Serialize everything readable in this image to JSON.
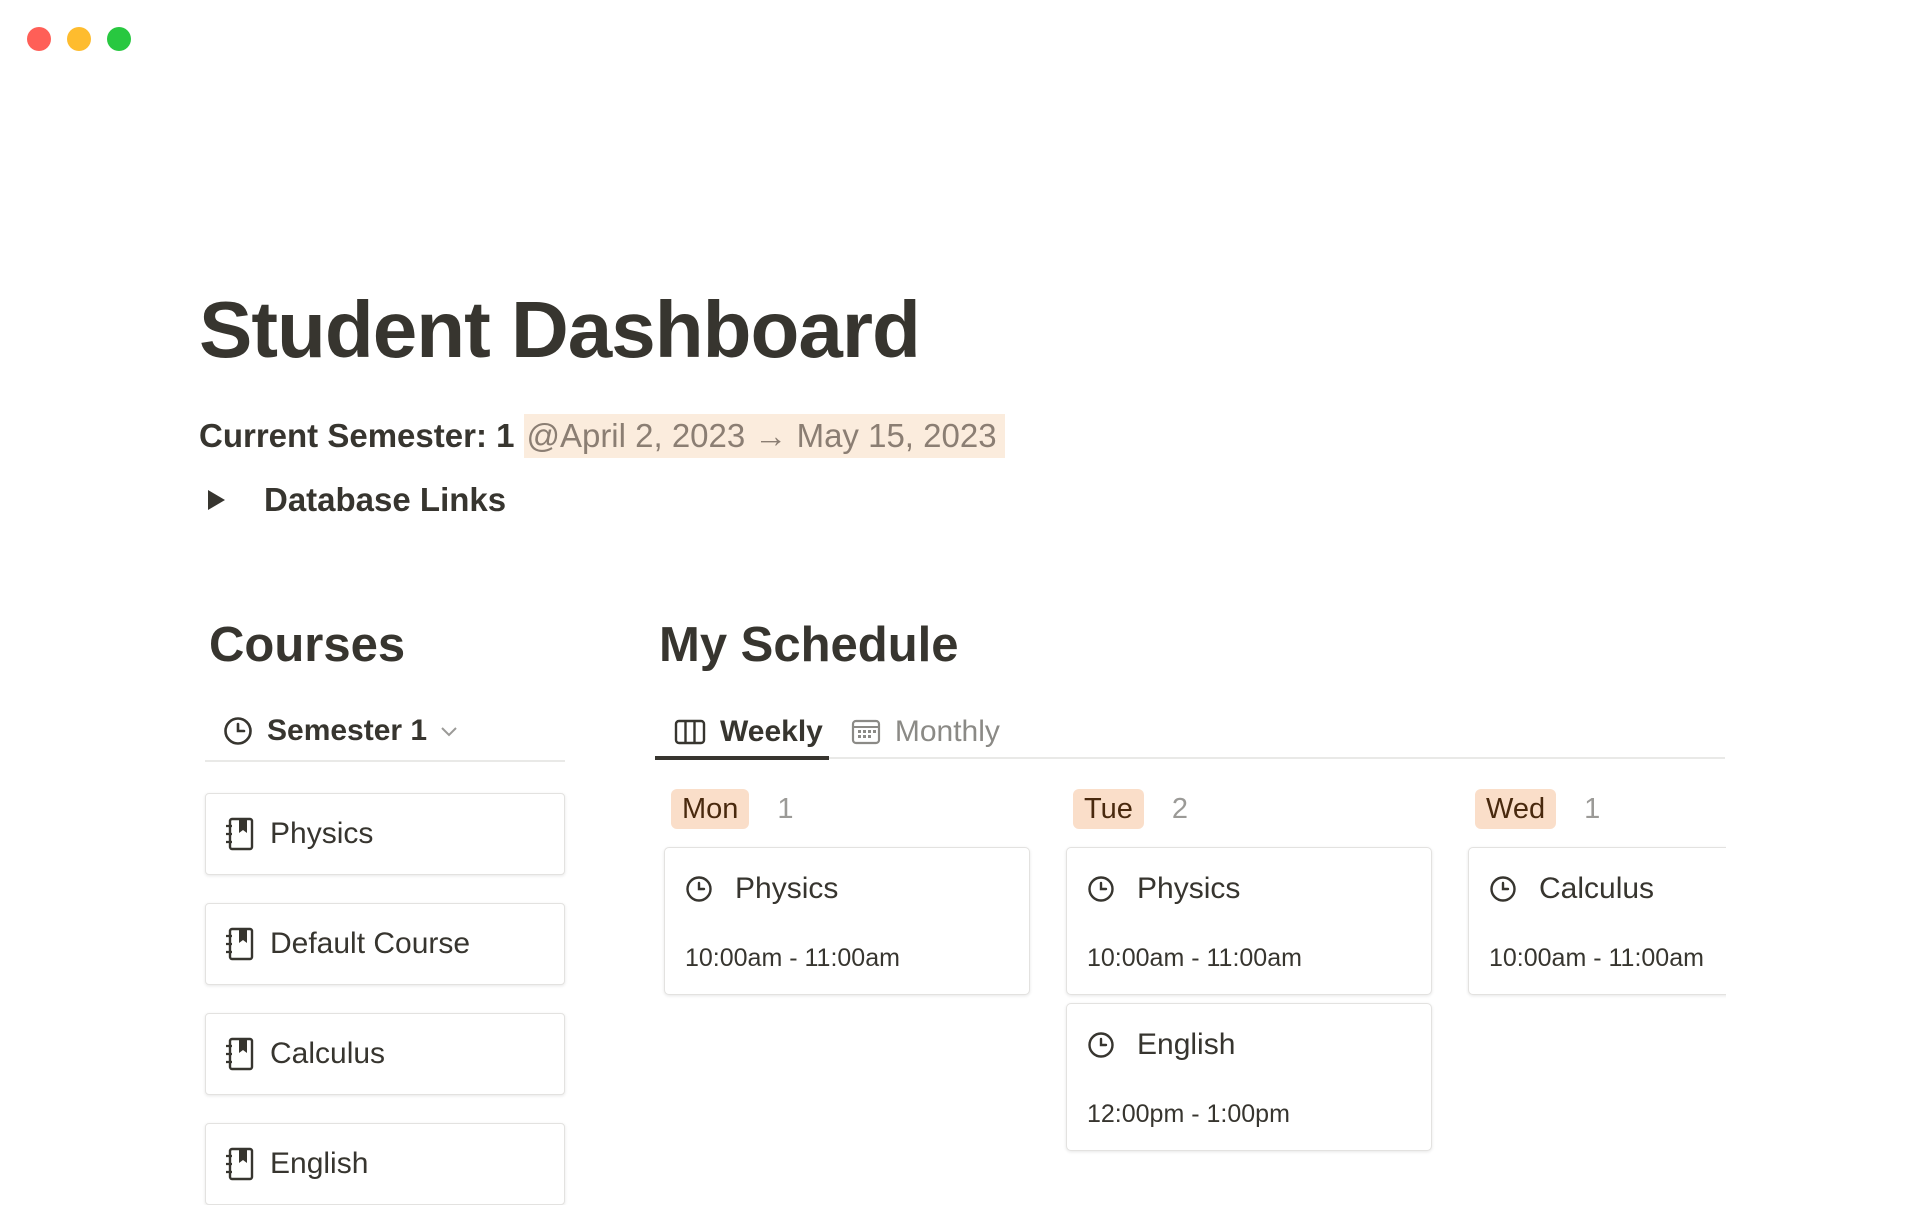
{
  "window": {
    "controls": {
      "close_color": "#ff5f57",
      "minimize_color": "#febc2e",
      "maximize_color": "#28c840"
    }
  },
  "page": {
    "title": "Student Dashboard",
    "semester_label": "Current Semester: 1",
    "semester_dates": "@April 2, 2023 → May 15, 2023",
    "toggle_label": "Database Links"
  },
  "courses": {
    "heading": "Courses",
    "view_label": "Semester 1",
    "items": [
      {
        "label": "Physics"
      },
      {
        "label": "Default Course"
      },
      {
        "label": "Calculus"
      },
      {
        "label": "English"
      }
    ]
  },
  "schedule": {
    "heading": "My Schedule",
    "tabs": [
      {
        "label": "Weekly",
        "icon": "board-icon",
        "active": true
      },
      {
        "label": "Monthly",
        "icon": "calendar-icon",
        "active": false
      }
    ],
    "columns": [
      {
        "day": "Mon",
        "count": "1",
        "events": [
          {
            "title": "Physics",
            "time": "10:00am - 11:00am"
          }
        ]
      },
      {
        "day": "Tue",
        "count": "2",
        "events": [
          {
            "title": "Physics",
            "time": "10:00am - 11:00am"
          },
          {
            "title": "English",
            "time": "12:00pm - 1:00pm"
          }
        ]
      },
      {
        "day": "Wed",
        "count": "1",
        "events": [
          {
            "title": "Calculus",
            "time": "10:00am - 11:00am"
          }
        ]
      }
    ]
  },
  "colors": {
    "text": "#37352f",
    "date_highlight_bg": "#fbecdd",
    "day_pill_bg": "#fadec9",
    "day_pill_text": "#49290e"
  }
}
